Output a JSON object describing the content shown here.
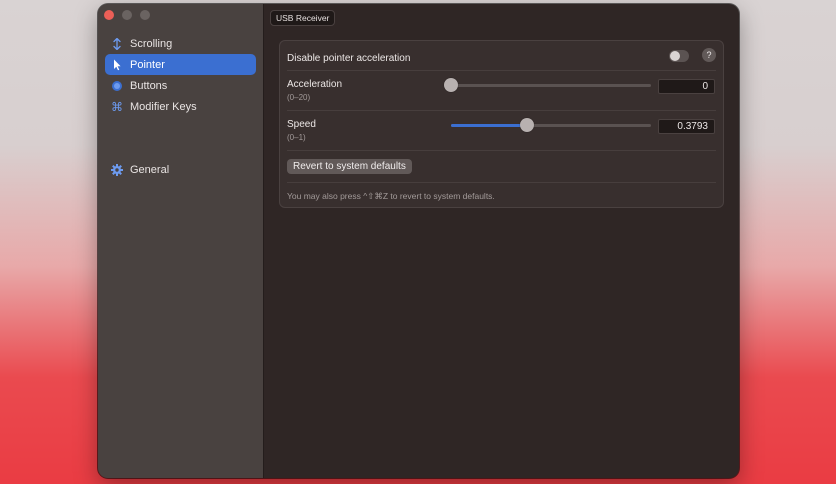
{
  "window": {
    "device_tab": "USB Receiver"
  },
  "sidebar": {
    "items": [
      {
        "label": "Scrolling",
        "icon": "updown-arrows-icon",
        "selected": false
      },
      {
        "label": "Pointer",
        "icon": "pointer-arrow-icon",
        "selected": true
      },
      {
        "label": "Buttons",
        "icon": "circle-icon",
        "selected": false
      },
      {
        "label": "Modifier Keys",
        "icon": "command-key-icon",
        "selected": false
      },
      {
        "label": "General",
        "icon": "gear-icon",
        "selected": false
      }
    ]
  },
  "panel": {
    "disable_accel_label": "Disable pointer acceleration",
    "disable_accel_on": false,
    "help_label": "?",
    "acceleration": {
      "label": "Acceleration",
      "range": "(0–20)",
      "value": "0",
      "fraction": 0.0
    },
    "speed": {
      "label": "Speed",
      "range": "(0–1)",
      "value": "0.3793",
      "fraction": 0.3793
    },
    "revert_label": "Revert to system defaults",
    "hint": "You may also press ^⇧⌘Z to revert to system defaults."
  },
  "colors": {
    "accent": "#3b6fd1",
    "sidebar_bg": "#494240",
    "content_bg": "#2f2625"
  }
}
